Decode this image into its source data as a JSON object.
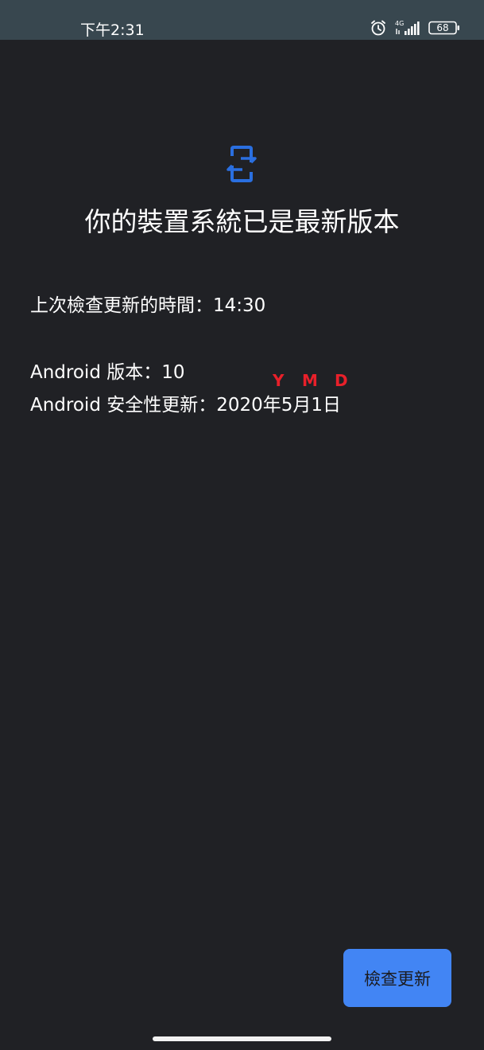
{
  "status_bar": {
    "time": "下午2:31",
    "network_label": "4G",
    "battery_level": "68",
    "icons": [
      "alarm-icon",
      "signal-icon",
      "battery-icon"
    ]
  },
  "main": {
    "icon": "phone-update-icon",
    "title": "你的裝置系統已是最新版本",
    "last_check": "上次檢查更新的時間：14:30",
    "android_version": "Android 版本：10",
    "security_patch": "Android 安全性更新：2020年5月1日"
  },
  "annotations": {
    "y": "Y",
    "m": "M",
    "d": "D"
  },
  "actions": {
    "check_update_label": "檢查更新"
  },
  "colors": {
    "background": "#202125",
    "status_bar": "#38474f",
    "accent": "#4285f4",
    "annotation": "#e8202a"
  }
}
